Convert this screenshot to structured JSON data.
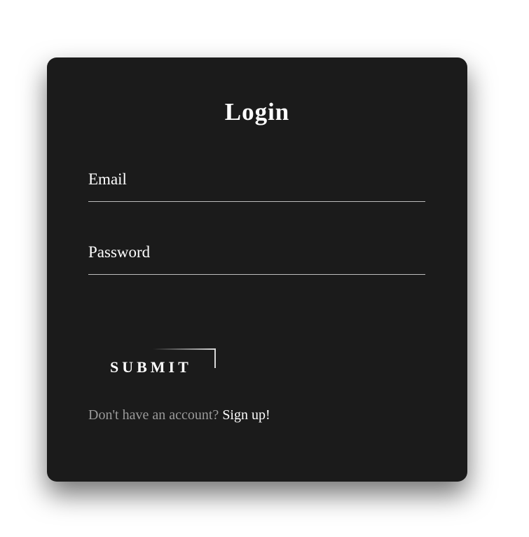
{
  "login": {
    "title": "Login",
    "email_label": "Email",
    "email_value": "",
    "password_label": "Password",
    "password_value": "",
    "submit_label": "SUBMIT",
    "signup_prompt": "Don't have an account?",
    "signup_link": "Sign up!"
  },
  "colors": {
    "page_background": "#ffffff",
    "card_background": "#1b1b1b",
    "text_primary": "#ffffff",
    "text_muted": "#9a9a9a",
    "field_underline": "#bdbdbd"
  }
}
